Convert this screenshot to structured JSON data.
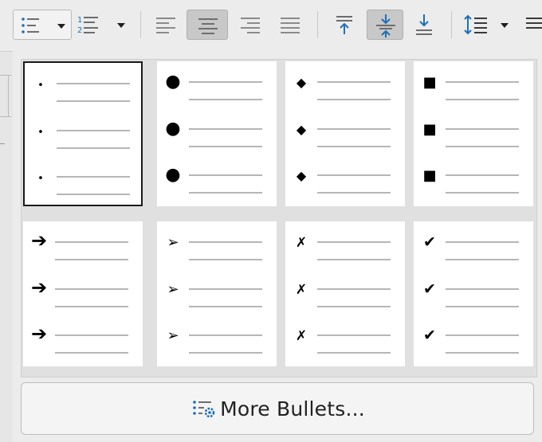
{
  "toolbar": {
    "buttons": [
      {
        "id": "unordered-list",
        "icon": "bullet-list-icon",
        "state": "open",
        "has_dropdown": true
      },
      {
        "id": "ordered-list",
        "icon": "numbered-list-icon",
        "state": "normal",
        "has_dropdown": true
      },
      {
        "id": "align-left",
        "icon": "align-left-icon",
        "state": "normal"
      },
      {
        "id": "align-center",
        "icon": "align-center-icon",
        "state": "pressed"
      },
      {
        "id": "align-right",
        "icon": "align-right-icon",
        "state": "normal"
      },
      {
        "id": "justify",
        "icon": "justify-icon",
        "state": "normal"
      },
      {
        "id": "align-top",
        "icon": "align-top-icon",
        "state": "normal"
      },
      {
        "id": "center-vertically",
        "icon": "center-vertically-icon",
        "state": "pressed"
      },
      {
        "id": "align-bottom",
        "icon": "align-bottom-icon",
        "state": "normal"
      },
      {
        "id": "line-spacing",
        "icon": "line-spacing-icon",
        "state": "normal",
        "has_dropdown": true
      },
      {
        "id": "paragraph-spacing",
        "icon": "paragraph-spacing-icon",
        "state": "normal"
      }
    ]
  },
  "bullets": {
    "styles": [
      {
        "name": "small-dot",
        "glyph": "•",
        "selected": true
      },
      {
        "name": "large-dot",
        "glyph": "●",
        "selected": false
      },
      {
        "name": "diamond",
        "glyph": "◆",
        "selected": false
      },
      {
        "name": "square",
        "glyph": "■",
        "selected": false
      },
      {
        "name": "arrow",
        "glyph": "➔",
        "selected": false
      },
      {
        "name": "arrowhead",
        "glyph": "➢",
        "selected": false
      },
      {
        "name": "cross",
        "glyph": "✗",
        "selected": false
      },
      {
        "name": "check",
        "glyph": "✔",
        "selected": false
      }
    ]
  },
  "more_bullets": {
    "label": "More Bullets...",
    "icon": "bullet-settings-icon"
  },
  "colors": {
    "accent": "#1e6fb8",
    "ink": "#1f1f1f"
  }
}
